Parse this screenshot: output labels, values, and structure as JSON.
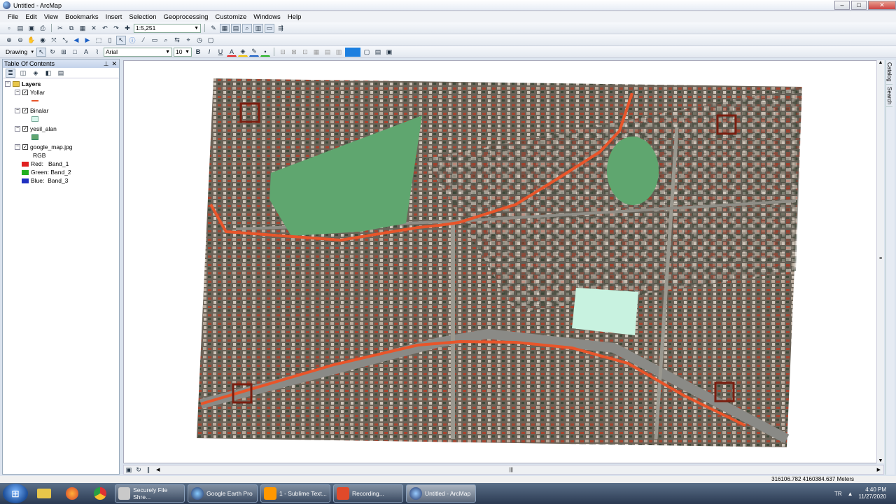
{
  "window": {
    "title": "Untitled - ArcMap"
  },
  "menu": [
    "File",
    "Edit",
    "View",
    "Bookmarks",
    "Insert",
    "Selection",
    "Geoprocessing",
    "Customize",
    "Windows",
    "Help"
  ],
  "toolbar": {
    "scale": "1:5,251",
    "drawing_label": "Drawing",
    "font": "Arial",
    "font_size": "10",
    "bold": "B",
    "italic": "I",
    "underline": "U"
  },
  "toc": {
    "title": "Table Of Contents",
    "root": "Layers",
    "layers": [
      {
        "name": "Yollar",
        "symbol": "line",
        "color": "#e8552a"
      },
      {
        "name": "Binalar",
        "symbol": "fill",
        "color": "#d8f5ec"
      },
      {
        "name": "yesil_alan",
        "symbol": "fill",
        "color": "#5fa66f"
      },
      {
        "name": "google_map.jpg",
        "symbol": "raster",
        "color": "#808080"
      }
    ],
    "raster_mode": "RGB",
    "bands": [
      {
        "label": "Red:   Band_1",
        "color": "#e02020"
      },
      {
        "label": "Green: Band_2",
        "color": "#20b020"
      },
      {
        "label": "Blue:  Band_3",
        "color": "#2030c0"
      }
    ]
  },
  "dock": [
    "Catalog",
    "Search"
  ],
  "status": {
    "coords": "316106.782  4160384.637 Meters"
  },
  "taskbar": {
    "items": [
      "Securely File Shre...",
      "Google Earth Pro",
      "1 - Sublime Text...",
      "Recording...",
      "Untitled - ArcMap"
    ],
    "time": "4:40 PM",
    "date": "11/27/2020",
    "lang": "TR"
  },
  "map": {
    "road_color": "#e8552a",
    "green_color": "#5fa66f",
    "building_color": "#c8f2e0",
    "marker_color": "#7a1e10"
  }
}
